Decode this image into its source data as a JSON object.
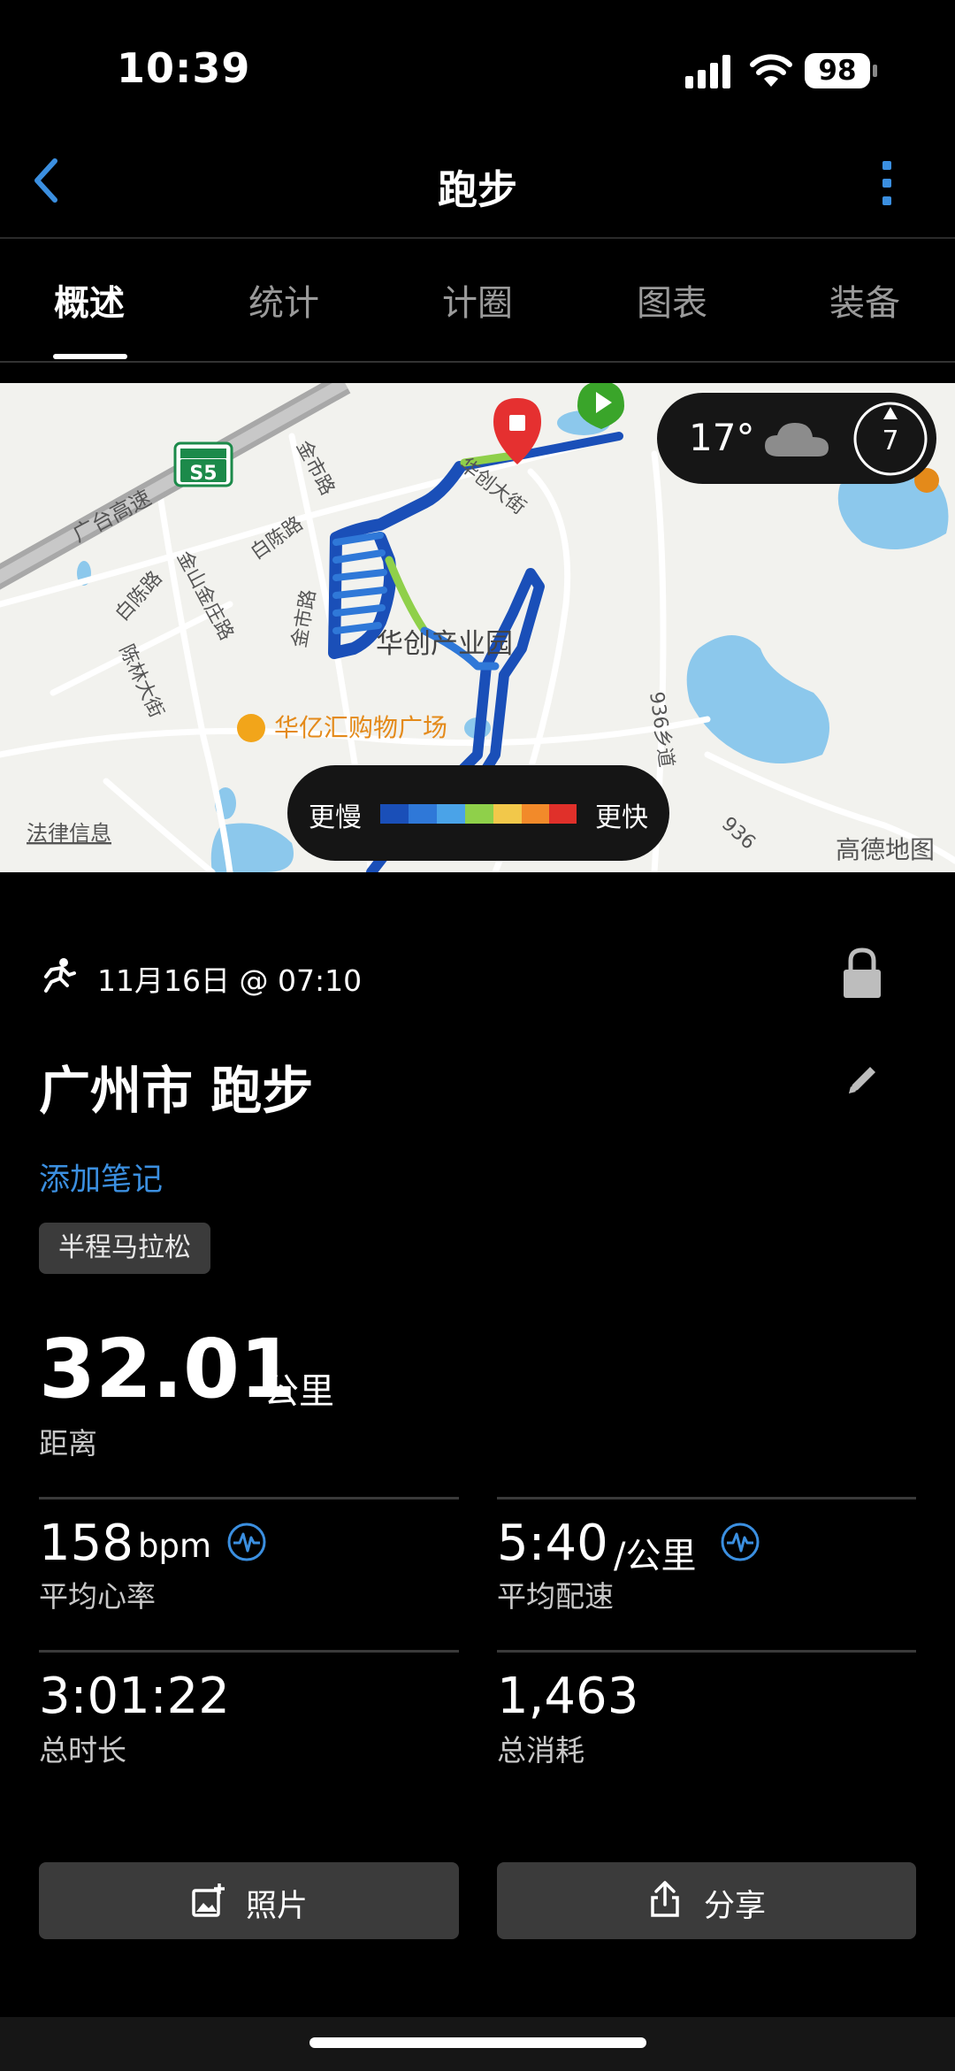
{
  "status_bar": {
    "time": "10:39",
    "battery": "98"
  },
  "nav": {
    "title": "跑步",
    "back_icon": "chevron-left-icon",
    "more_icon": "more-vertical-icon",
    "accent": "#3b8fe0"
  },
  "tabs": [
    {
      "label": "概述",
      "active": true
    },
    {
      "label": "统计",
      "active": false
    },
    {
      "label": "计圈",
      "active": false
    },
    {
      "label": "图表",
      "active": false
    },
    {
      "label": "装备",
      "active": false
    }
  ],
  "map": {
    "labels": {
      "park": "华创产业园",
      "mall": "华亿汇购物广场",
      "highway": "广台高速",
      "road1": "华创大街",
      "road2": "金市路",
      "road3": "白陈路",
      "road4": "金山金庄路",
      "road5": "陈林大街",
      "road6": "936乡道",
      "road7": "936",
      "shield": "S5",
      "legal": "法律信息",
      "provider": "高德地图"
    },
    "weather": {
      "temperature": "17°",
      "condition_icon": "cloud-icon",
      "wind": "7"
    },
    "pace_legend": {
      "slow": "更慢",
      "fast": "更快",
      "colors": [
        "#1a4fb8",
        "#2f78d8",
        "#4aa3e8",
        "#8fd04a",
        "#f2c84a",
        "#f28a2a",
        "#e0302a"
      ]
    }
  },
  "activity": {
    "date": "11月16日 @ 07:10",
    "title": "广州市 跑步",
    "add_note": "添加笔记",
    "tag": "半程马拉松"
  },
  "distance": {
    "value": "32.01",
    "unit": "公里",
    "label": "距离"
  },
  "stats": [
    {
      "value": "158",
      "unit": "bpm",
      "label": "平均心率",
      "badge": "activity-wave-icon"
    },
    {
      "value": "5:40",
      "unit": "/公里",
      "label": "平均配速",
      "badge": "activity-wave-icon"
    },
    {
      "value": "3:01:22",
      "unit": "",
      "label": "总时长"
    },
    {
      "value": "1,463",
      "unit": "",
      "label": "总消耗"
    }
  ],
  "buttons": {
    "photos": "照片",
    "share": "分享"
  }
}
